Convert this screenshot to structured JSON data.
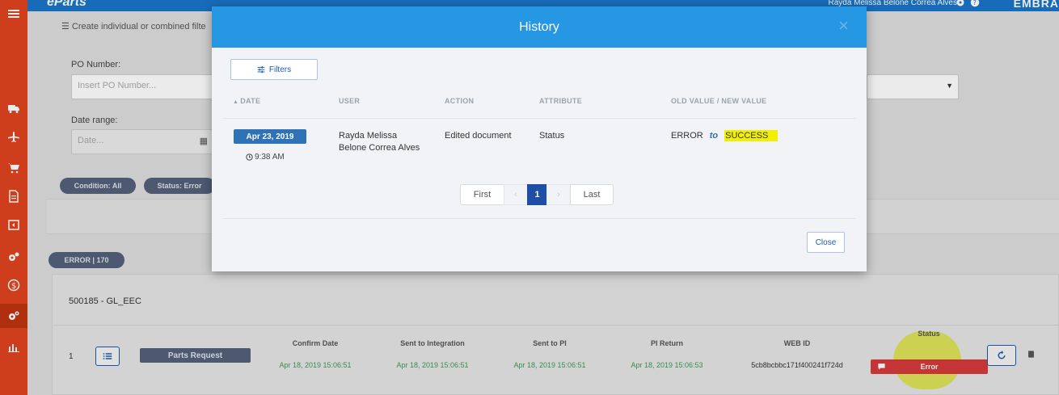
{
  "header": {
    "brand": "eParts",
    "user_name": "Rayda Melissa Belone Correa Alves",
    "logo_text": "EMBRA"
  },
  "background": {
    "filter_hint": "Create individual or combined filte",
    "po_number_label": "PO Number:",
    "po_number_placeholder": "Insert PO Number...",
    "date_range_label": "Date range:",
    "date_placeholder": "Date...",
    "chips": [
      "Condition: All",
      "Status: Error"
    ],
    "error_count_chip": "ERROR | 170",
    "card": {
      "title": "500185 - GL_EEC",
      "row_number": "1",
      "parts_request": "Parts Request",
      "columns": [
        {
          "header": "Confirm Date",
          "value": "Apr 18, 2019 15:06:51"
        },
        {
          "header": "Sent to Integration",
          "value": "Apr 18, 2019 15:06:51"
        },
        {
          "header": "Sent to PI",
          "value": "Apr 18, 2019 15:06:51"
        },
        {
          "header": "PI Return",
          "value": "Apr 18, 2019 15:06:53"
        },
        {
          "header": "WEB ID",
          "value": "5cb8bcbbc171f400241f724d"
        }
      ],
      "status_header": "Status",
      "status_value": "Error"
    }
  },
  "modal": {
    "title": "History",
    "close_icon": "×",
    "filters_label": "Filters",
    "columns": {
      "date": "DATE",
      "user": "USER",
      "action": "ACTION",
      "attribute": "ATTRIBUTE",
      "values": "OLD VALUE / NEW VALUE"
    },
    "rows": [
      {
        "date": "Apr 23, 2019",
        "time": "9:38 AM",
        "user_line1": "Rayda Melissa",
        "user_line2": "Belone Correa Alves",
        "action": "Edited document",
        "attribute": "Status",
        "old_value": "ERROR",
        "to_word": "to",
        "new_value": "SUCCESS"
      }
    ],
    "pagination": {
      "first": "First",
      "prev": "‹",
      "current": "1",
      "next": "›",
      "last": "Last"
    },
    "close_button": "Close"
  },
  "colors": {
    "accent": "#2697e3",
    "sidebar": "#e0441f",
    "highlight": "#f2f000",
    "error": "#d63a3a",
    "success_text": "#3b9a55"
  }
}
